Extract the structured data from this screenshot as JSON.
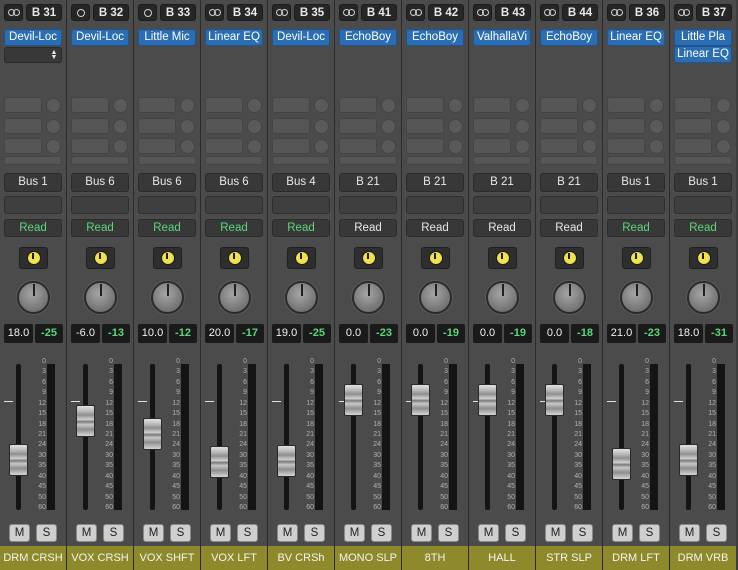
{
  "channels": [
    {
      "link": "double",
      "input": "B 31",
      "inserts": [
        "Devil-Loc"
      ],
      "selector": true,
      "output": "Bus 1",
      "automation": "Read",
      "automation_color": "#5bd77a",
      "volume": "18.0",
      "peak": "-25",
      "fader_level": 0.28,
      "name": "DRM CRSH"
    },
    {
      "link": "single",
      "input": "B 32",
      "inserts": [
        "Devil-Loc"
      ],
      "selector": false,
      "output": "Bus 6",
      "automation": "Read",
      "automation_color": "#5bd77a",
      "volume": "-6.0",
      "peak": "-13",
      "fader_level": 0.6,
      "name": "VOX CRSH"
    },
    {
      "link": "single",
      "input": "B 33",
      "inserts": [
        "Little Mic"
      ],
      "selector": false,
      "output": "Bus 6",
      "automation": "Read",
      "automation_color": "#5bd77a",
      "volume": "10.0",
      "peak": "-12",
      "fader_level": 0.49,
      "name": "VOX SHFT"
    },
    {
      "link": "double",
      "input": "B 34",
      "inserts": [
        "Linear EQ"
      ],
      "selector": false,
      "output": "Bus 6",
      "automation": "Read",
      "automation_color": "#5bd77a",
      "volume": "20.0",
      "peak": "-17",
      "fader_level": 0.26,
      "name": "VOX LFT"
    },
    {
      "link": "double",
      "input": "B 35",
      "inserts": [
        "Devil-Loc"
      ],
      "selector": false,
      "output": "Bus 4",
      "automation": "Read",
      "automation_color": "#5bd77a",
      "volume": "19.0",
      "peak": "-25",
      "fader_level": 0.27,
      "name": "BV CRSh"
    },
    {
      "link": "double",
      "input": "B 41",
      "inserts": [
        "EchoBoy"
      ],
      "selector": false,
      "output": "B 21",
      "automation": "Read",
      "automation_color": "#e8e8e8",
      "volume": "0.0",
      "peak": "-23",
      "fader_level": 0.77,
      "name": "MONO SLP"
    },
    {
      "link": "double",
      "input": "B 42",
      "inserts": [
        "EchoBoy"
      ],
      "selector": false,
      "output": "B 21",
      "automation": "Read",
      "automation_color": "#e8e8e8",
      "volume": "0.0",
      "peak": "-19",
      "fader_level": 0.77,
      "name": "8TH"
    },
    {
      "link": "double",
      "input": "B 43",
      "inserts": [
        "ValhallaVi"
      ],
      "selector": false,
      "output": "B 21",
      "automation": "Read",
      "automation_color": "#e8e8e8",
      "volume": "0.0",
      "peak": "-19",
      "fader_level": 0.77,
      "name": "HALL"
    },
    {
      "link": "double",
      "input": "B 44",
      "inserts": [
        "EchoBoy"
      ],
      "selector": false,
      "output": "B 21",
      "automation": "Read",
      "automation_color": "#e8e8e8",
      "volume": "0.0",
      "peak": "-18",
      "fader_level": 0.77,
      "name": "STR SLP"
    },
    {
      "link": "double",
      "input": "B 36",
      "inserts": [
        "Linear EQ"
      ],
      "selector": false,
      "output": "Bus 1",
      "automation": "Read",
      "automation_color": "#5bd77a",
      "volume": "21.0",
      "peak": "-23",
      "fader_level": 0.25,
      "name": "DRM LFT"
    },
    {
      "link": "double",
      "input": "B 37",
      "inserts": [
        "Little Pla",
        "Linear EQ"
      ],
      "selector": false,
      "output": "Bus 1",
      "automation": "Read",
      "automation_color": "#5bd77a",
      "volume": "18.0",
      "peak": "-31",
      "fader_level": 0.28,
      "name": "DRM VRB"
    }
  ],
  "mute_label": "M",
  "solo_label": "S",
  "scale_ticks": [
    "0",
    "3",
    "6",
    "9",
    "12",
    "15",
    "18",
    "21",
    "24",
    "30",
    "35",
    "40",
    "45",
    "50",
    "60"
  ],
  "icons": {
    "link": "stereo-link-icon",
    "stepper": "stepper-icon",
    "ruler": "ruler-icon",
    "knob": "pan-knob"
  },
  "colors": {
    "insert_blue": "#2a6db3",
    "read_green": "#5bd77a",
    "name_plate": "#8e8a2c",
    "readout_peak": "#5bd77a"
  }
}
